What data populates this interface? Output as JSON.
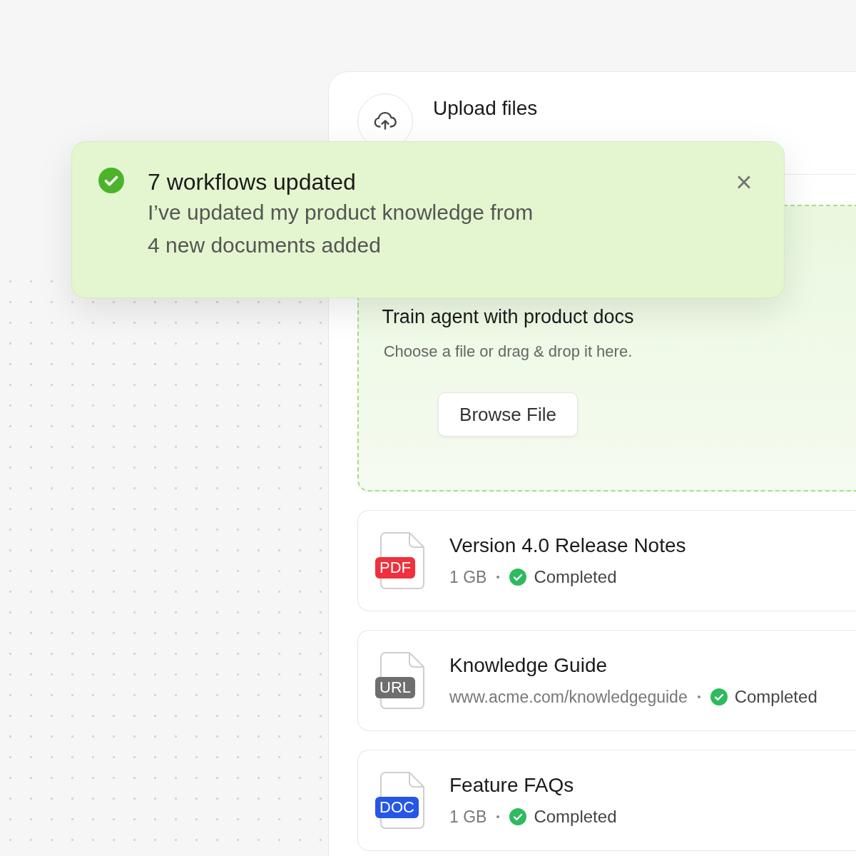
{
  "upload_panel": {
    "title": "Upload files"
  },
  "dropzone": {
    "title": "Train agent with product docs",
    "hint": "Choose a file or drag & drop it here.",
    "button": "Browse File"
  },
  "files": [
    {
      "badge": "PDF",
      "color": "#f0303c",
      "name": "Version 4.0 Release Notes",
      "detail": "1 GB",
      "status": "Completed"
    },
    {
      "badge": "URL",
      "color": "#6e6e6e",
      "name": "Knowledge Guide",
      "detail": "www.acme.com/knowledgeguide",
      "status": "Completed"
    },
    {
      "badge": "DOC",
      "color": "#2556e8",
      "name": "Feature FAQs",
      "detail": "1 GB",
      "status": "Completed"
    }
  ],
  "toast": {
    "title": "7 workflows updated",
    "lines": [
      "I’ve updated my product knowledge from",
      "4 new documents added"
    ],
    "close": "×"
  }
}
